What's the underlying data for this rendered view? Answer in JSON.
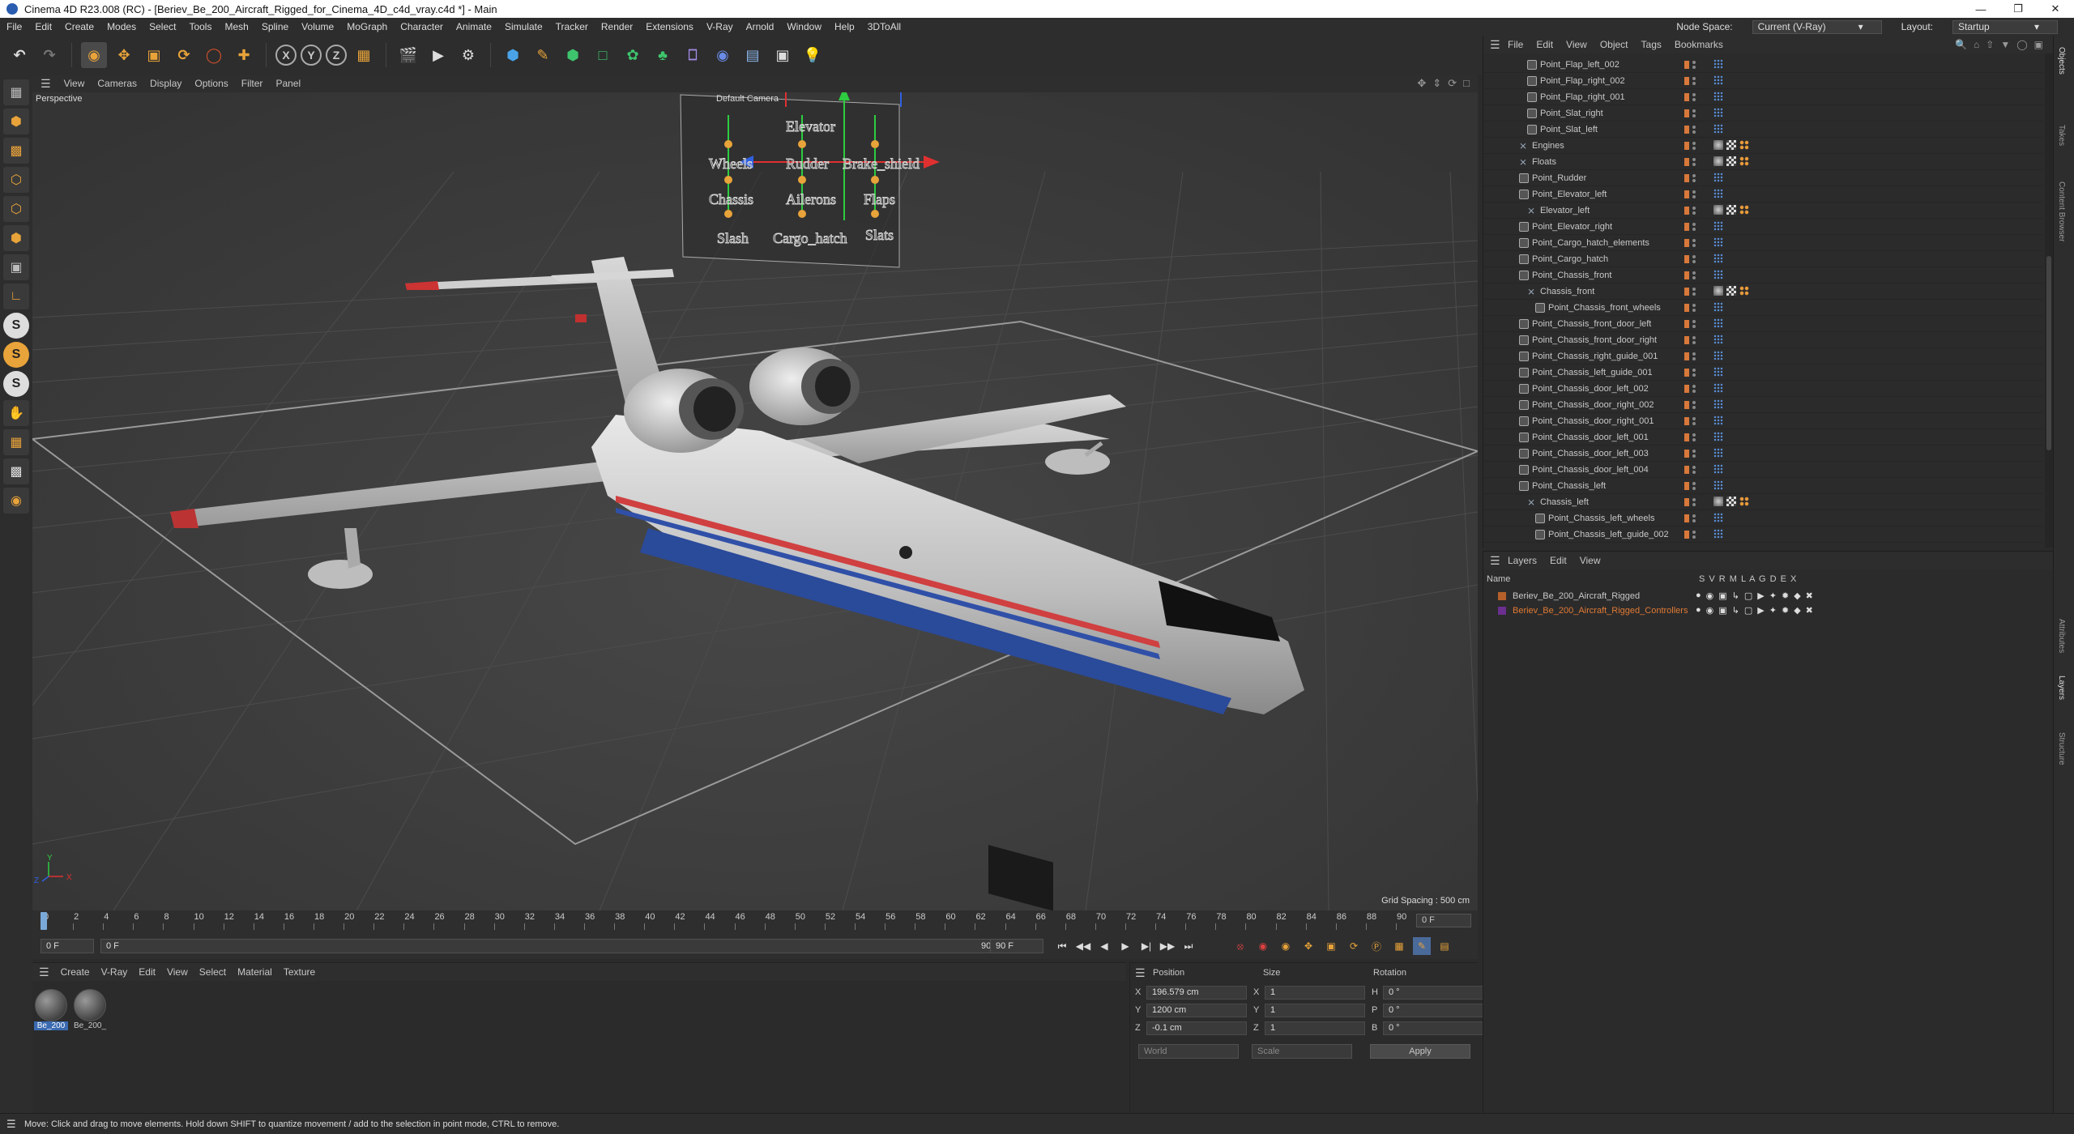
{
  "window": {
    "title": "Cinema 4D R23.008 (RC) - [Beriev_Be_200_Aircraft_Rigged_for_Cinema_4D_c4d_vray.c4d *] - Main"
  },
  "menubar": {
    "items": [
      "File",
      "Edit",
      "Create",
      "Modes",
      "Select",
      "Tools",
      "Mesh",
      "Spline",
      "Volume",
      "MoGraph",
      "Character",
      "Animate",
      "Simulate",
      "Tracker",
      "Render",
      "Extensions",
      "V-Ray",
      "Arnold",
      "Window",
      "Help",
      "3DToAll"
    ],
    "node_space_label": "Node Space:",
    "node_space_value": "Current (V-Ray)",
    "layout_label": "Layout:",
    "layout_value": "Startup"
  },
  "toolbar": {
    "axis_x": "X",
    "axis_y": "Y",
    "axis_z": "Z"
  },
  "left_toolbar": {
    "s1": "S",
    "s2": "S",
    "s3": "S"
  },
  "viewport": {
    "menu": [
      "View",
      "Cameras",
      "Display",
      "Options",
      "Filter",
      "Panel"
    ],
    "label": "Perspective",
    "camera_label": "Default Camera",
    "grid_spacing": "Grid Spacing : 500 cm",
    "axis_y": "Y",
    "axis_x": "X",
    "axis_z": "Z",
    "controller_labels": [
      "Elevator",
      "Wheels",
      "Rudder",
      "Brake_shield",
      "Chassis",
      "Ailerons",
      "Flaps",
      "Slash",
      "Cargo_hatch",
      "Slats"
    ]
  },
  "timeline": {
    "ticks": [
      "0",
      "2",
      "4",
      "6",
      "8",
      "10",
      "12",
      "14",
      "16",
      "18",
      "20",
      "22",
      "24",
      "26",
      "28",
      "30",
      "32",
      "34",
      "36",
      "38",
      "40",
      "42",
      "44",
      "46",
      "48",
      "50",
      "52",
      "54",
      "56",
      "58",
      "60",
      "62",
      "64",
      "66",
      "68",
      "70",
      "72",
      "74",
      "76",
      "78",
      "80",
      "82",
      "84",
      "86",
      "88",
      "90"
    ],
    "current_frame": "0 F",
    "start_field": "0 F",
    "preview_start": "0 F",
    "preview_end": "90 F",
    "end_field": "90 F"
  },
  "materials": {
    "menu": [
      "Create",
      "V-Ray",
      "Edit",
      "View",
      "Select",
      "Material",
      "Texture"
    ],
    "items": [
      {
        "name": "Be_200"
      },
      {
        "name": "Be_200_"
      }
    ]
  },
  "attributes": {
    "headers": {
      "position": "Position",
      "size": "Size",
      "rotation": "Rotation"
    },
    "rows": [
      {
        "axis": "X",
        "pos": "196.579 cm",
        "size_axis": "X",
        "size": "1",
        "rot_axis": "H",
        "rot": "0 °"
      },
      {
        "axis": "Y",
        "pos": "1200 cm",
        "size_axis": "Y",
        "size": "1",
        "rot_axis": "P",
        "rot": "0 °"
      },
      {
        "axis": "Z",
        "pos": "-0.1 cm",
        "size_axis": "Z",
        "size": "1",
        "rot_axis": "B",
        "rot": "0 °"
      }
    ],
    "coord_system": "World",
    "size_mode": "Scale",
    "apply": "Apply"
  },
  "objects": {
    "menu": [
      "File",
      "Edit",
      "View",
      "Object",
      "Tags",
      "Bookmarks"
    ],
    "rows": [
      {
        "name": "Point_Flap_left_002",
        "indent": 3,
        "type": "point",
        "tags": "dots"
      },
      {
        "name": "Point_Flap_right_002",
        "indent": 3,
        "type": "point",
        "tags": "dots"
      },
      {
        "name": "Point_Flap_right_001",
        "indent": 3,
        "type": "point",
        "tags": "dots"
      },
      {
        "name": "Point_Slat_right",
        "indent": 3,
        "type": "point",
        "tags": "dots"
      },
      {
        "name": "Point_Slat_left",
        "indent": 3,
        "type": "point",
        "tags": "dots"
      },
      {
        "name": "Engines",
        "indent": 2,
        "type": "null",
        "tags": "mat"
      },
      {
        "name": "Floats",
        "indent": 2,
        "type": "null",
        "tags": "mat"
      },
      {
        "name": "Point_Rudder",
        "indent": 2,
        "type": "point",
        "tags": "dots"
      },
      {
        "name": "Point_Elevator_left",
        "indent": 2,
        "type": "point",
        "tags": "dots"
      },
      {
        "name": "Elevator_left",
        "indent": 3,
        "type": "null",
        "tags": "mat"
      },
      {
        "name": "Point_Elevator_right",
        "indent": 2,
        "type": "point",
        "tags": "dots"
      },
      {
        "name": "Point_Cargo_hatch_elements",
        "indent": 2,
        "type": "point",
        "tags": "dots"
      },
      {
        "name": "Point_Cargo_hatch",
        "indent": 2,
        "type": "point",
        "tags": "dots"
      },
      {
        "name": "Point_Chassis_front",
        "indent": 2,
        "type": "point",
        "tags": "dots"
      },
      {
        "name": "Chassis_front",
        "indent": 3,
        "type": "null",
        "tags": "mat"
      },
      {
        "name": "Point_Chassis_front_wheels",
        "indent": 4,
        "type": "point",
        "tags": "dots"
      },
      {
        "name": "Point_Chassis_front_door_left",
        "indent": 2,
        "type": "point",
        "tags": "dots"
      },
      {
        "name": "Point_Chassis_front_door_right",
        "indent": 2,
        "type": "point",
        "tags": "dots"
      },
      {
        "name": "Point_Chassis_right_guide_001",
        "indent": 2,
        "type": "point",
        "tags": "dots"
      },
      {
        "name": "Point_Chassis_left_guide_001",
        "indent": 2,
        "type": "point",
        "tags": "dots"
      },
      {
        "name": "Point_Chassis_door_left_002",
        "indent": 2,
        "type": "point",
        "tags": "dots"
      },
      {
        "name": "Point_Chassis_door_right_002",
        "indent": 2,
        "type": "point",
        "tags": "dots"
      },
      {
        "name": "Point_Chassis_door_right_001",
        "indent": 2,
        "type": "point",
        "tags": "dots"
      },
      {
        "name": "Point_Chassis_door_left_001",
        "indent": 2,
        "type": "point",
        "tags": "dots"
      },
      {
        "name": "Point_Chassis_door_left_003",
        "indent": 2,
        "type": "point",
        "tags": "dots"
      },
      {
        "name": "Point_Chassis_door_left_004",
        "indent": 2,
        "type": "point",
        "tags": "dots"
      },
      {
        "name": "Point_Chassis_left",
        "indent": 2,
        "type": "point",
        "tags": "dots"
      },
      {
        "name": "Chassis_left",
        "indent": 3,
        "type": "null",
        "tags": "mat"
      },
      {
        "name": "Point_Chassis_left_wheels",
        "indent": 4,
        "type": "point",
        "tags": "dots"
      },
      {
        "name": "Point_Chassis_left_guide_002",
        "indent": 4,
        "type": "point",
        "tags": "dots"
      }
    ]
  },
  "layers": {
    "menu": [
      "Layers",
      "Edit",
      "View"
    ],
    "header_name": "Name",
    "header_cols": "S V R M L A G D E X",
    "rows": [
      {
        "name": "Beriev_Be_200_Aircraft_Rigged",
        "color": "#b5602a",
        "text_color": "#c8c8c8"
      },
      {
        "name": "Beriev_Be_200_Aircraft_Rigged_Controllers",
        "color": "#6a2f8f",
        "text_color": "#e07a35"
      }
    ]
  },
  "right_tabs": [
    "Objects",
    "Takes",
    "Content Browser",
    "Attributes",
    "Layers",
    "Structure"
  ],
  "status": {
    "text": "Move: Click and drag to move elements. Hold down SHIFT to quantize movement / add to the selection in point mode, CTRL to remove."
  }
}
